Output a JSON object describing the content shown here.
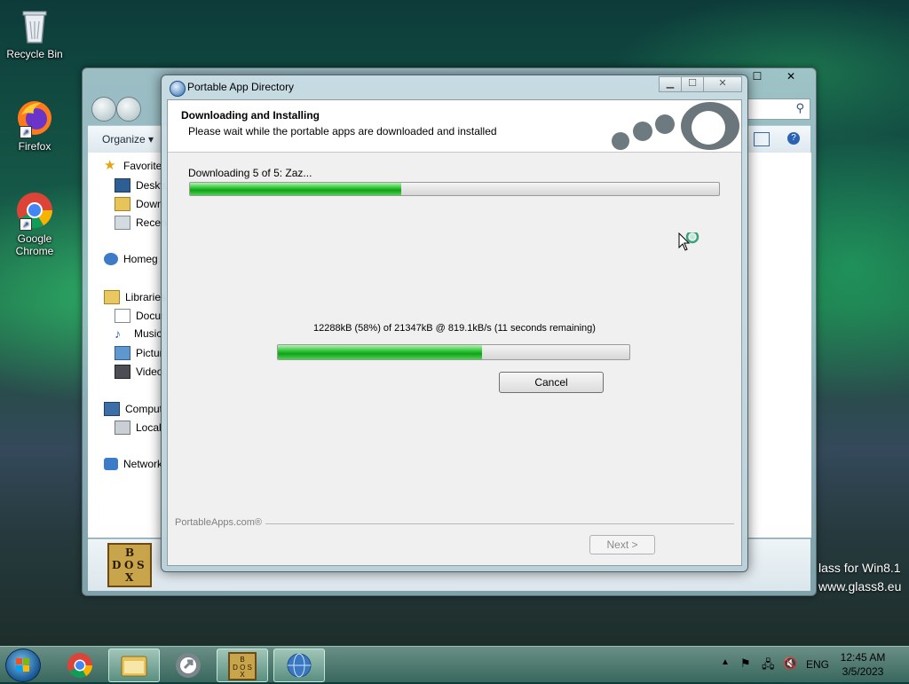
{
  "desktop": {
    "icons": [
      {
        "label": "Recycle Bin"
      },
      {
        "label": "Firefox"
      },
      {
        "label": "Google Chrome"
      }
    ],
    "watermark_line1": "lass for Win8.1",
    "watermark_line2": "www.glass8.eu"
  },
  "explorer": {
    "toolbar": {
      "organize_label": "Organize ▾"
    },
    "nav": [
      {
        "label": "Favorite"
      },
      {
        "label": "Deskto"
      },
      {
        "label": "Down"
      },
      {
        "label": "Recen"
      },
      {
        "label": "Homeg"
      },
      {
        "label": "Libraries"
      },
      {
        "label": "Docur"
      },
      {
        "label": "Music"
      },
      {
        "label": "Pictur"
      },
      {
        "label": "Video"
      },
      {
        "label": "Comput"
      },
      {
        "label": "Local"
      },
      {
        "label": "Network"
      }
    ]
  },
  "dialog": {
    "title": "Portable App Directory",
    "header_title": "Downloading and Installing",
    "header_subtitle": "Please wait while the portable apps are downloaded and installed",
    "status": "Downloading 5 of 5: Zaz...",
    "overall_progress": 0.4,
    "transfer_text": "12288kB (58%) of 21347kB @ 819.1kB/s (11 seconds remaining)",
    "file_progress": 0.58,
    "cancel_label": "Cancel",
    "brand": "PortableApps.com®",
    "next_label": "Next >"
  },
  "taskbar": {
    "language": "ENG",
    "time": "12:45 AM",
    "date": "3/5/2023"
  }
}
